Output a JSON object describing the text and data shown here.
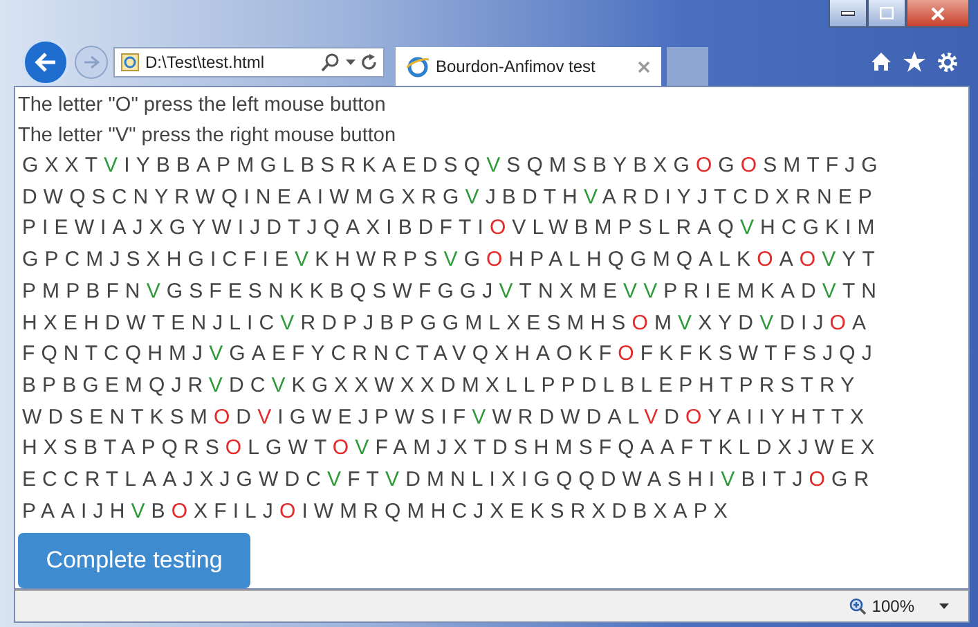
{
  "address_bar": {
    "value": "D:\\Test\\test.html"
  },
  "tab": {
    "title": "Bourdon-Anfimov test"
  },
  "instructions": [
    "The letter \"O\" press the left mouse button",
    "The letter \"V\" press the right mouse button"
  ],
  "grid": {
    "lines": [
      [
        {
          "text": "GXXT"
        },
        {
          "text": "V",
          "color": "#2f9a3a"
        },
        {
          "text": "IYBBAPMGLBSRKAEDSQ"
        },
        {
          "text": "V",
          "color": "#2f9a3a"
        },
        {
          "text": "SQMSBYBXG"
        },
        {
          "text": "O",
          "color": "#e42b2b"
        },
        {
          "text": "G"
        },
        {
          "text": "O",
          "color": "#e42b2b"
        },
        {
          "text": "SMTFJG"
        }
      ],
      [
        {
          "text": "DWQSCNYRWQINEAIWMGXRG"
        },
        {
          "text": "V",
          "color": "#2f9a3a"
        },
        {
          "text": "JBDTH"
        },
        {
          "text": "V",
          "color": "#2f9a3a"
        },
        {
          "text": "ARDIYJTCDXRNEP"
        }
      ],
      [
        {
          "text": "PIEWIAJXGYWIJDTJQAXIBDFTI"
        },
        {
          "text": "O",
          "color": "#e42b2b"
        },
        {
          "text": "VLWBMPSLRAQ"
        },
        {
          "text": "V",
          "color": "#2f9a3a"
        },
        {
          "text": "HCGKIM"
        }
      ],
      [
        {
          "text": "GPCMJSXHGICFIE"
        },
        {
          "text": "V",
          "color": "#2f9a3a"
        },
        {
          "text": "KHWRPS"
        },
        {
          "text": "V",
          "color": "#2f9a3a"
        },
        {
          "text": "G"
        },
        {
          "text": "O",
          "color": "#e42b2b"
        },
        {
          "text": "HPALHQGMQALK"
        },
        {
          "text": "O",
          "color": "#e42b2b"
        },
        {
          "text": "A"
        },
        {
          "text": "O",
          "color": "#e42b2b"
        },
        {
          "text": "V",
          "color": "#2f9a3a"
        },
        {
          "text": "YT"
        }
      ],
      [
        {
          "text": "PMPBFN"
        },
        {
          "text": "V",
          "color": "#2f9a3a"
        },
        {
          "text": "GSFESNKKBQSWFGGJ"
        },
        {
          "text": "V",
          "color": "#2f9a3a"
        },
        {
          "text": "TNXME"
        },
        {
          "text": "V",
          "color": "#2f9a3a"
        },
        {
          "text": "V",
          "color": "#2f9a3a"
        },
        {
          "text": "PRIEMKAD"
        },
        {
          "text": "V",
          "color": "#2f9a3a"
        },
        {
          "text": "TN"
        }
      ],
      [
        {
          "text": "HXEHDWTENJLIC"
        },
        {
          "text": "V",
          "color": "#2f9a3a"
        },
        {
          "text": "RDPJBPGGMLXESMHS"
        },
        {
          "text": "O",
          "color": "#e42b2b"
        },
        {
          "text": "M"
        },
        {
          "text": "V",
          "color": "#2f9a3a"
        },
        {
          "text": "XYD"
        },
        {
          "text": "V",
          "color": "#2f9a3a"
        },
        {
          "text": "DIJ"
        },
        {
          "text": "O",
          "color": "#e42b2b"
        },
        {
          "text": "A"
        }
      ],
      [
        {
          "text": "FQNTCQHMJ"
        },
        {
          "text": "V",
          "color": "#2f9a3a"
        },
        {
          "text": "GAEFYCRNCTAVQXHAOKF"
        },
        {
          "text": "O",
          "color": "#e42b2b"
        },
        {
          "text": "FKFKSWTFSJQJ"
        }
      ],
      [
        {
          "text": "BPBGEMQJR"
        },
        {
          "text": "V",
          "color": "#2f9a3a"
        },
        {
          "text": "DC"
        },
        {
          "text": "V",
          "color": "#2f9a3a"
        },
        {
          "text": "KGXXWXXDMXLLPPDLBLEPHTPRSTRY"
        }
      ],
      [
        {
          "text": "WDSENTKSM"
        },
        {
          "text": "O",
          "color": "#e42b2b"
        },
        {
          "text": "D"
        },
        {
          "text": "V",
          "color": "#e42b2b"
        },
        {
          "text": "IGWEJPWSIF"
        },
        {
          "text": "V",
          "color": "#2f9a3a"
        },
        {
          "text": "WRDWDAL"
        },
        {
          "text": "V",
          "color": "#e42b2b"
        },
        {
          "text": "D"
        },
        {
          "text": "O",
          "color": "#e42b2b"
        },
        {
          "text": "YAIIYHTTX"
        }
      ],
      [
        {
          "text": "HXSBTAPQRS"
        },
        {
          "text": "O",
          "color": "#e42b2b"
        },
        {
          "text": "LGWT"
        },
        {
          "text": "O",
          "color": "#e42b2b"
        },
        {
          "text": "V",
          "color": "#2f9a3a"
        },
        {
          "text": "FAMJXTDSHMSFQAAFTKLDXJWEX"
        }
      ],
      [
        {
          "text": "ECCRTLAAJXJGWDC"
        },
        {
          "text": "V",
          "color": "#2f9a3a"
        },
        {
          "text": "FT"
        },
        {
          "text": "V",
          "color": "#2f9a3a"
        },
        {
          "text": "DMNLIXIGQQDWASHI"
        },
        {
          "text": "V",
          "color": "#2f9a3a"
        },
        {
          "text": "BITJ"
        },
        {
          "text": "O",
          "color": "#e42b2b"
        },
        {
          "text": "GR"
        }
      ],
      [
        {
          "text": "PAAIJH"
        },
        {
          "text": "V",
          "color": "#2f9a3a"
        },
        {
          "text": "B"
        },
        {
          "text": "O",
          "color": "#e42b2b"
        },
        {
          "text": "XFILJ"
        },
        {
          "text": "O",
          "color": "#e42b2b"
        },
        {
          "text": "IWMRQMHCJXEKSRXDBXAPX"
        }
      ]
    ]
  },
  "button": "Complete testing",
  "status_bar": {
    "zoom": "100%"
  }
}
